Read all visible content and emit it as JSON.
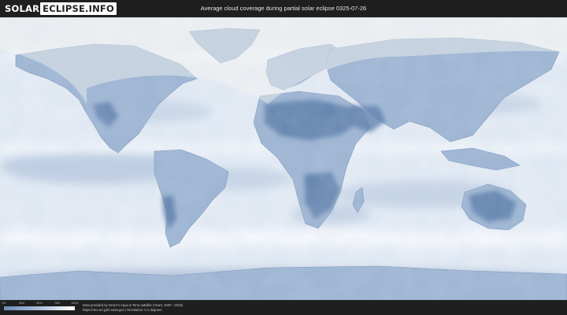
{
  "header": {
    "logo_part1": "SOLAR",
    "logo_part2": "ECLIPSE.INFO",
    "title": "Average cloud coverage during partial solar eclipse 0325-07-26"
  },
  "legend": {
    "ticks": [
      "0%",
      "25%",
      "50%",
      "75%",
      "100%"
    ],
    "colors": {
      "clear": "#6d8db5",
      "mid": "#a9bfdb",
      "overcast": "#ffffff"
    }
  },
  "footer": {
    "credit_line1": "Data provided by NASA's Aqua & Terra satellite (Years: 2000 - 2019)",
    "credit_line2": "https://neo.sci.gsfc.nasa.gov  |  Resolution: 0.1 degrees"
  },
  "colors": {
    "background": "#1f1f1f",
    "ocean_cloud": "#e4ebf4",
    "land_clear": "#8fa9c9",
    "eclipse_shade": "#f3f3ef"
  }
}
